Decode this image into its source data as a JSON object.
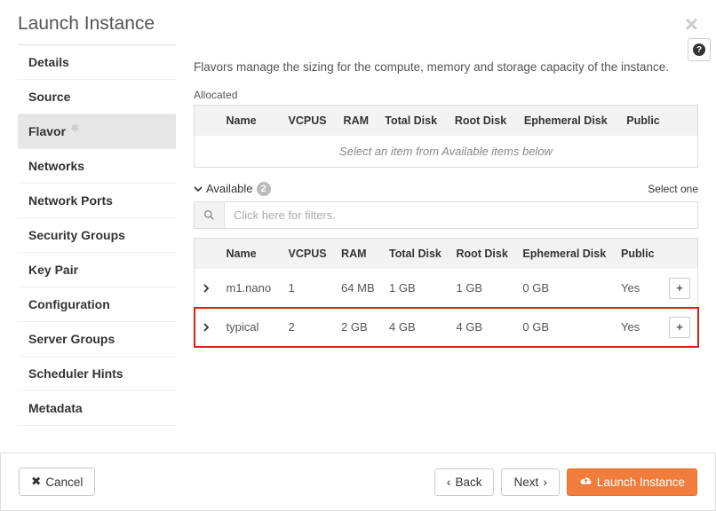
{
  "modal": {
    "title": "Launch Instance"
  },
  "sidebar": {
    "items": [
      {
        "label": "Details"
      },
      {
        "label": "Source"
      },
      {
        "label": "Flavor",
        "required": true,
        "selected": true
      },
      {
        "label": "Networks"
      },
      {
        "label": "Network Ports"
      },
      {
        "label": "Security Groups"
      },
      {
        "label": "Key Pair"
      },
      {
        "label": "Configuration"
      },
      {
        "label": "Server Groups"
      },
      {
        "label": "Scheduler Hints"
      },
      {
        "label": "Metadata"
      }
    ]
  },
  "description": "Flavors manage the sizing for the compute, memory and storage capacity of the instance.",
  "allocated": {
    "label": "Allocated",
    "headers": {
      "name": "Name",
      "vcpus": "VCPUS",
      "ram": "RAM",
      "total_disk": "Total Disk",
      "root_disk": "Root Disk",
      "ephemeral_disk": "Ephemeral Disk",
      "public": "Public"
    },
    "empty_message": "Select an item from Available items below"
  },
  "available": {
    "label": "Available",
    "count": "2",
    "select_one": "Select one",
    "filter_placeholder": "Click here for filters.",
    "rows": [
      {
        "name": "m1.nano",
        "vcpus": "1",
        "ram": "64 MB",
        "total_disk": "1 GB",
        "root_disk": "1 GB",
        "ephemeral_disk": "0 GB",
        "public": "Yes"
      },
      {
        "name": "typical",
        "vcpus": "2",
        "ram": "2 GB",
        "total_disk": "4 GB",
        "root_disk": "4 GB",
        "ephemeral_disk": "0 GB",
        "public": "Yes"
      }
    ]
  },
  "footer": {
    "cancel": "Cancel",
    "back": "Back",
    "next": "Next",
    "launch": "Launch Instance"
  }
}
